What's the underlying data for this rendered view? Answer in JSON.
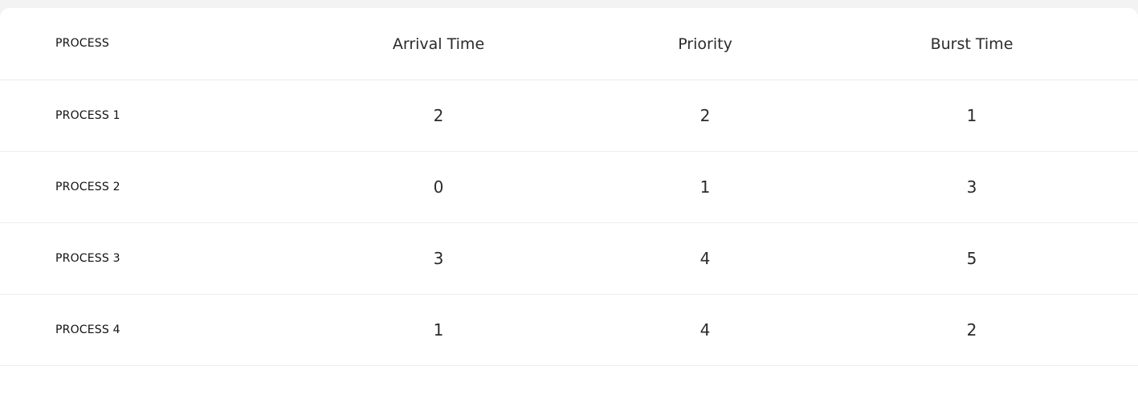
{
  "table": {
    "headers": [
      "PROCESS",
      "Arrival Time",
      "Priority",
      "Burst Time"
    ],
    "rows": [
      {
        "process": "PROCESS 1",
        "arrival": "2",
        "priority": "2",
        "burst": "1"
      },
      {
        "process": "PROCESS 2",
        "arrival": "0",
        "priority": "1",
        "burst": "3"
      },
      {
        "process": "PROCESS 3",
        "arrival": "3",
        "priority": "4",
        "burst": "5"
      },
      {
        "process": "PROCESS 4",
        "arrival": "1",
        "priority": "4",
        "burst": "2"
      }
    ]
  }
}
